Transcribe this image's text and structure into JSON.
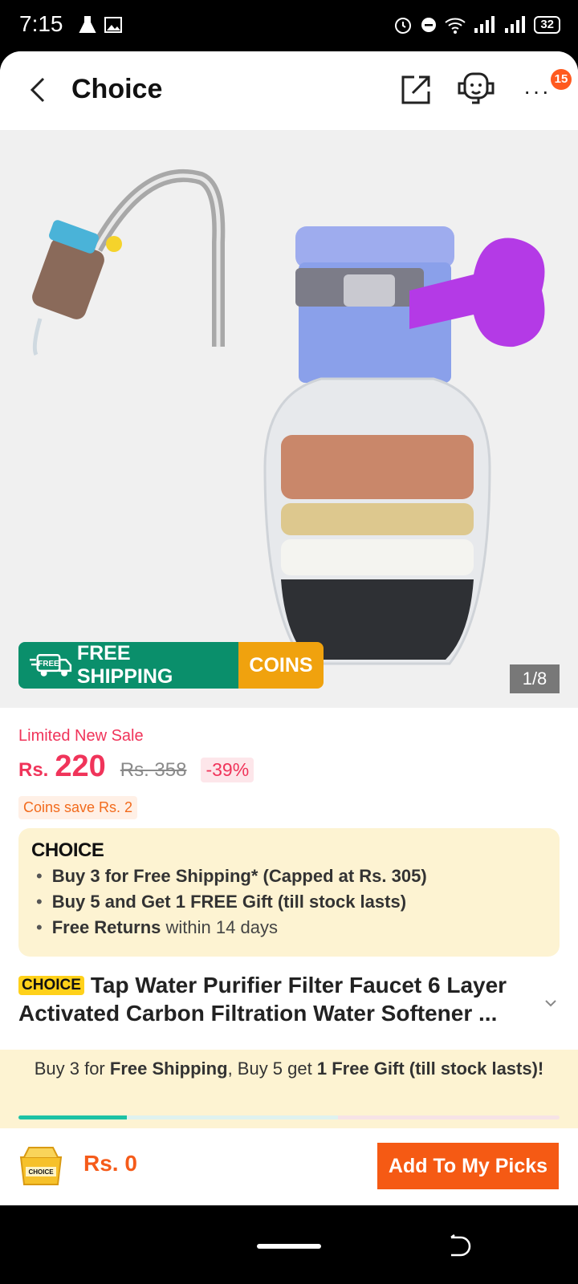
{
  "status_bar": {
    "time": "7:15",
    "battery": "32"
  },
  "header": {
    "title": "Choice",
    "more_label": "···",
    "notification_count": "15"
  },
  "hero": {
    "free_shipping": "FREE SHIPPING",
    "free_tag": "FREE",
    "coins": "COINS",
    "image_counter": "1/8"
  },
  "price": {
    "sale_label": "Limited New Sale",
    "currency": "Rs.",
    "current": "220",
    "original": "Rs. 358",
    "discount": "-39%",
    "coins_save": "Coins save Rs. 2"
  },
  "choice_box": {
    "logo": "CHOICE",
    "item1_bold": "Buy 3 for  Free Shipping* (Capped at Rs. 305)",
    "item2_bold": "Buy 5 and Get 1 FREE Gift (till stock lasts)",
    "item3_bold": "Free Returns",
    "item3_rest": " within 14 days"
  },
  "product": {
    "tag": "CHOICE",
    "title": "Tap Water Purifier Filter Faucet 6 Layer Activated Carbon Filtration Water Softener ..."
  },
  "promo": {
    "p1": "Buy 3 for ",
    "p2": "Free Shipping",
    "p3": ", Buy 5 get ",
    "p4": "1 Free Gift (till stock lasts)!",
    "progress": 0.2
  },
  "bottom": {
    "cart_label": "CHOICE",
    "total": "Rs. 0",
    "add_button": "Add To My Picks"
  },
  "colors": {
    "accent": "#f55a14",
    "price": "#f0345a",
    "shipping_green": "#0a8f6b",
    "coins_orange": "#f0a20e",
    "choice_bg": "#fdf3d2"
  }
}
